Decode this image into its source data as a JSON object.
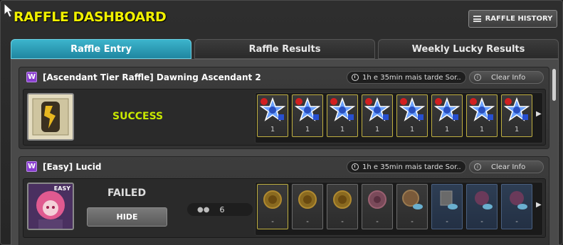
{
  "title": "RAFFLE DASHBOARD",
  "history_button": {
    "label": "RAFFLE HISTORY",
    "icon": "menu-icon"
  },
  "tabs": [
    {
      "label": "Raffle Entry",
      "active": true
    },
    {
      "label": "Raffle Results",
      "active": false
    },
    {
      "label": "Weekly Lucky Results",
      "active": false
    }
  ],
  "raffles": [
    {
      "badge": "W",
      "title": "[Ascendant Tier Raffle] Dawning Ascendant 2",
      "time": "1h e 35min mais tarde Sor..",
      "clear_label": "Clear Info",
      "status": "SUCCESS",
      "status_color": "#c8e800",
      "items": [
        {
          "count": "1",
          "icon": "star-coupon-icon"
        },
        {
          "count": "1",
          "icon": "star-coupon-icon"
        },
        {
          "count": "1",
          "icon": "star-coupon-icon"
        },
        {
          "count": "1",
          "icon": "star-coupon-icon"
        },
        {
          "count": "1",
          "icon": "star-coupon-icon"
        },
        {
          "count": "1",
          "icon": "star-coupon-icon"
        },
        {
          "count": "1",
          "icon": "star-coupon-icon"
        },
        {
          "count": "1",
          "icon": "star-coupon-icon"
        }
      ]
    },
    {
      "badge": "W",
      "title": "[Easy] Lucid",
      "time": "1h e 35min mais tarde Sor..",
      "clear_label": "Clear Info",
      "boss_tag": "EASY",
      "status": "FAILED",
      "status_color": "#dddddd",
      "hide_label": "HIDE",
      "party_count": "6",
      "items": [
        {
          "count": "-",
          "icon": "gold-coin-icon"
        },
        {
          "count": "-",
          "icon": "gold-coin-icon"
        },
        {
          "count": "-",
          "icon": "gold-coin-icon"
        },
        {
          "count": "-",
          "icon": "pink-coin-icon"
        },
        {
          "count": "-",
          "icon": "coin-cloud-icon"
        },
        {
          "count": "-",
          "icon": "box-cloud-icon"
        },
        {
          "count": "-",
          "icon": "pink-orb-icon"
        },
        {
          "count": "-",
          "icon": "pink-orb-icon"
        }
      ]
    }
  ]
}
